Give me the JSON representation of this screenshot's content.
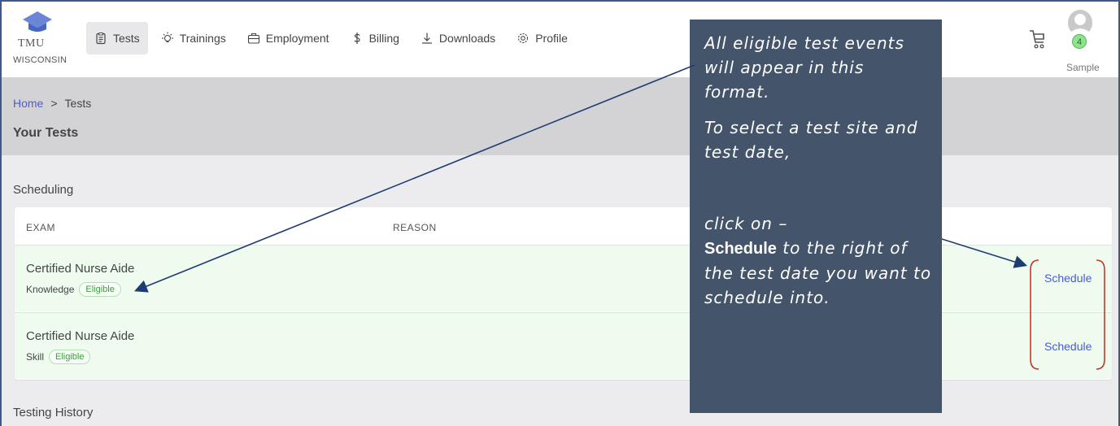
{
  "logo": {
    "line1": "TMU",
    "line2": "WISCONSIN"
  },
  "nav": [
    {
      "label": "Tests",
      "icon": "clipboard-icon",
      "active": true
    },
    {
      "label": "Trainings",
      "icon": "lightbulb-icon"
    },
    {
      "label": "Employment",
      "icon": "briefcase-icon"
    },
    {
      "label": "Billing",
      "icon": "dollar-icon"
    },
    {
      "label": "Downloads",
      "icon": "download-icon"
    },
    {
      "label": "Profile",
      "icon": "gear-icon"
    }
  ],
  "cart": {
    "icon": "cart-icon"
  },
  "user": {
    "count": "4",
    "name": "Sample"
  },
  "breadcrumb": {
    "home": "Home",
    "separator": ">",
    "current": "Tests"
  },
  "page_title": "Your Tests",
  "scheduling": {
    "title": "Scheduling",
    "columns": {
      "exam": "EXAM",
      "reason": "REASON"
    },
    "rows": [
      {
        "title": "Certified Nurse Aide",
        "type": "Knowledge",
        "status": "Eligible",
        "action": "Schedule"
      },
      {
        "title": "Certified Nurse Aide",
        "type": "Skill",
        "status": "Eligible",
        "action": "Schedule"
      }
    ]
  },
  "history": {
    "title": "Testing History"
  },
  "callout": {
    "p1": "All eligible test events will appear in this format.",
    "p2": "To select a test site and test date,",
    "p3a": "click on –",
    "p3b": "Schedule",
    "p3c": " to the right of the test date you want to schedule into."
  },
  "colors": {
    "accent_link": "#4a5bd8",
    "eligible_green": "#3b9c3b",
    "row_bg": "#eefbee",
    "callout_bg": "#44546a",
    "arrow": "#1f3b73",
    "bracket": "#c0392b"
  }
}
